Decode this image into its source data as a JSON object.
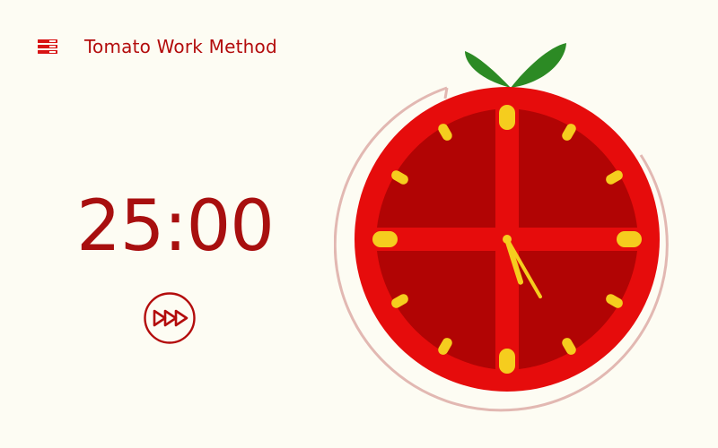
{
  "app": {
    "title": "Tomato Work Method"
  },
  "timer": {
    "display": "25:00"
  },
  "controls": {
    "menu_icon": "menu-icon",
    "skip_icon": "fast-forward-icon"
  },
  "clock": {
    "hour": 5,
    "minute": 25,
    "colors": {
      "accent": "#b30c0c",
      "tomato": "#e60c0c",
      "tomato_dark": "#b10404",
      "markers": "#f5cd1e",
      "leaf": "#2c8a24",
      "ring": "#e2b8b2",
      "background": "#fdfcf3"
    }
  }
}
